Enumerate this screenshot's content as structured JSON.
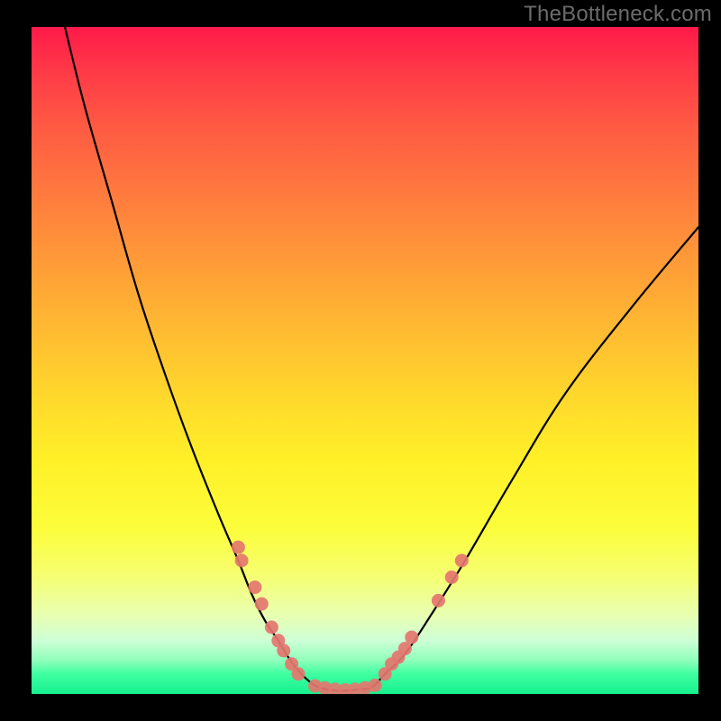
{
  "watermark": "TheBottleneck.com",
  "chart_data": {
    "type": "line",
    "title": "",
    "xlabel": "",
    "ylabel": "",
    "xlim": [
      0,
      100
    ],
    "ylim": [
      0,
      100
    ],
    "series": [
      {
        "name": "left-curve",
        "x": [
          5,
          8,
          12,
          16,
          20,
          24,
          28,
          31,
          33,
          35,
          37,
          38.5,
          40,
          41.5,
          43
        ],
        "values": [
          100,
          88,
          74,
          60,
          48,
          37,
          27,
          20,
          15,
          11,
          8,
          5.5,
          3.5,
          2,
          1
        ]
      },
      {
        "name": "valley-floor",
        "x": [
          43,
          45,
          47,
          49,
          51
        ],
        "values": [
          1,
          0.6,
          0.5,
          0.7,
          1
        ]
      },
      {
        "name": "right-curve",
        "x": [
          51,
          53,
          56,
          60,
          65,
          72,
          80,
          90,
          100
        ],
        "values": [
          1,
          3,
          6,
          12,
          20,
          32,
          45,
          58,
          70
        ]
      }
    ],
    "markers": [
      {
        "name": "left-cluster",
        "points": [
          {
            "x": 31,
            "y": 22
          },
          {
            "x": 31.5,
            "y": 20
          },
          {
            "x": 33.5,
            "y": 16
          },
          {
            "x": 34.5,
            "y": 13.5
          },
          {
            "x": 36,
            "y": 10
          },
          {
            "x": 37,
            "y": 8
          },
          {
            "x": 37.8,
            "y": 6.5
          },
          {
            "x": 39,
            "y": 4.5
          },
          {
            "x": 40,
            "y": 3
          }
        ]
      },
      {
        "name": "bottom-cluster",
        "points": [
          {
            "x": 42.5,
            "y": 1.2
          },
          {
            "x": 44,
            "y": 0.9
          },
          {
            "x": 45.5,
            "y": 0.7
          },
          {
            "x": 47,
            "y": 0.6
          },
          {
            "x": 48.5,
            "y": 0.7
          },
          {
            "x": 50,
            "y": 0.9
          },
          {
            "x": 51.5,
            "y": 1.3
          }
        ]
      },
      {
        "name": "right-cluster",
        "points": [
          {
            "x": 53,
            "y": 3
          },
          {
            "x": 54,
            "y": 4.5
          },
          {
            "x": 55,
            "y": 5.5
          },
          {
            "x": 56,
            "y": 6.8
          },
          {
            "x": 57,
            "y": 8.5
          },
          {
            "x": 61,
            "y": 14
          },
          {
            "x": 63,
            "y": 17.5
          },
          {
            "x": 64.5,
            "y": 20
          }
        ]
      }
    ],
    "colors": {
      "curve": "#000000",
      "marker_fill": "#e4766f",
      "marker_stroke": "#d95f5a",
      "gradient_top": "#ff1a4a",
      "gradient_bottom": "#16f08e"
    }
  }
}
